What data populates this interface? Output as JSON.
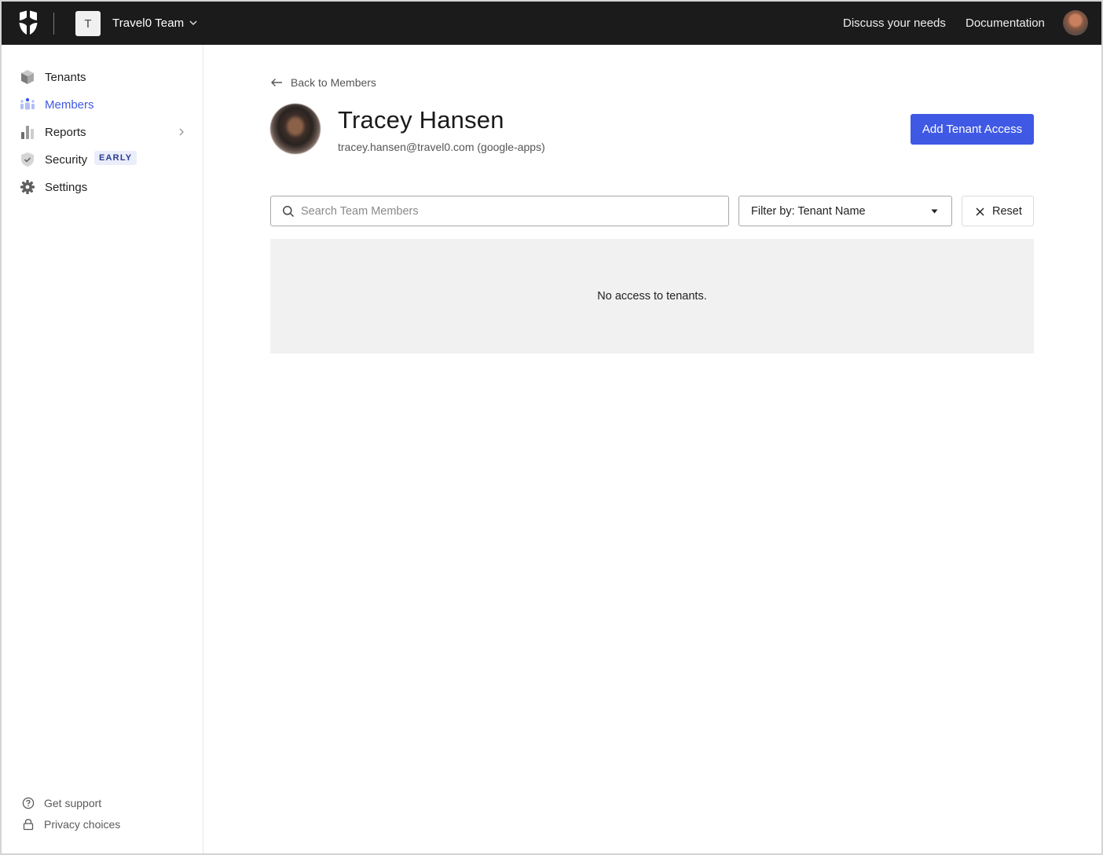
{
  "topbar": {
    "logo_icon": "shield-star-logo",
    "team_initial": "T",
    "team_name": "Travel0 Team",
    "team_chevron_icon": "chevron-down-icon",
    "links": [
      {
        "label": "Discuss your needs"
      },
      {
        "label": "Documentation"
      }
    ],
    "user_avatar_icon": "user-avatar"
  },
  "sidebar": {
    "items": [
      {
        "label": "Tenants",
        "icon": "cube-icon",
        "active": false
      },
      {
        "label": "Members",
        "icon": "users-icon",
        "active": true
      },
      {
        "label": "Reports",
        "icon": "bar-chart-icon",
        "active": false,
        "has_submenu": true
      },
      {
        "label": "Security",
        "icon": "shield-check-icon",
        "active": false,
        "badge": "EARLY"
      },
      {
        "label": "Settings",
        "icon": "gear-icon",
        "active": false
      }
    ],
    "footer": [
      {
        "label": "Get support",
        "icon": "help-circle-icon"
      },
      {
        "label": "Privacy choices",
        "icon": "lock-icon"
      }
    ]
  },
  "main": {
    "back_link": "Back to Members",
    "member": {
      "name": "Tracey Hansen",
      "email_line": "tracey.hansen@travel0.com (google-apps)"
    },
    "add_button": "Add Tenant Access",
    "search": {
      "placeholder": "Search Team Members",
      "value": ""
    },
    "filter": {
      "selected": "Filter by: Tenant Name"
    },
    "reset_button": "Reset",
    "empty_message": "No access to tenants."
  },
  "colors": {
    "accent": "#3f59e4",
    "topbar_bg": "#1b1b1b",
    "empty_panel_bg": "#f1f1f1"
  }
}
